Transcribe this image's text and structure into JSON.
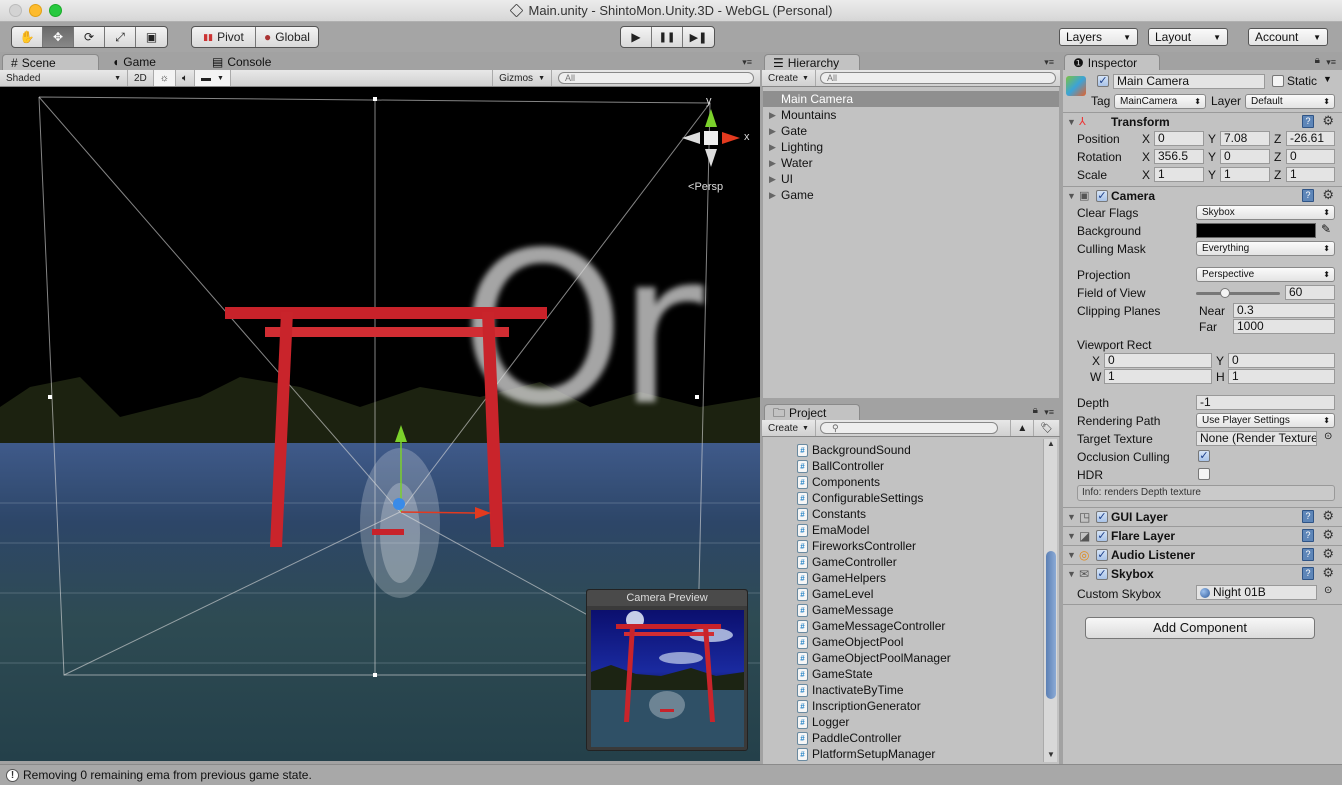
{
  "window": {
    "title": "Main.unity - ShintoMon.Unity.3D - WebGL (Personal)"
  },
  "toolbar": {
    "tools": [
      {
        "name": "hand-tool",
        "glyph": "✋"
      },
      {
        "name": "move-tool",
        "glyph": "✥"
      },
      {
        "name": "rotate-tool",
        "glyph": "⟳"
      },
      {
        "name": "scale-tool",
        "glyph": "⤢"
      },
      {
        "name": "rect-tool",
        "glyph": "▣"
      }
    ],
    "active_tool": "move-tool",
    "pivot_label": "Pivot",
    "global_label": "Global",
    "play_glyph": "▶",
    "pause_glyph": "❚❚",
    "step_glyph": "▶❚",
    "layers_label": "Layers",
    "layout_label": "Layout",
    "account_label": "Account"
  },
  "scene_panel": {
    "tabs": [
      {
        "label": "Scene",
        "icon": "#"
      },
      {
        "label": "Game",
        "icon": "◖"
      },
      {
        "label": "Console",
        "icon": "▤"
      }
    ],
    "shading_mode": "Shaded",
    "mode_2d_label": "2D",
    "gizmos_label": "Gizmos",
    "search_placeholder": "All",
    "gizmo_y": "y",
    "gizmo_x": "x",
    "projection_label": "Persp",
    "overlay_text": "Or",
    "camera_preview_title": "Camera Preview"
  },
  "hierarchy": {
    "tab_label": "Hierarchy",
    "create_label": "Create",
    "search_placeholder": "All",
    "items": [
      {
        "label": "Main Camera",
        "selected": true,
        "expandable": false
      },
      {
        "label": "Mountains",
        "selected": false,
        "expandable": true
      },
      {
        "label": "Gate",
        "selected": false,
        "expandable": true
      },
      {
        "label": "Lighting",
        "selected": false,
        "expandable": true
      },
      {
        "label": "Water",
        "selected": false,
        "expandable": true
      },
      {
        "label": "UI",
        "selected": false,
        "expandable": true
      },
      {
        "label": "Game",
        "selected": false,
        "expandable": true
      }
    ]
  },
  "project": {
    "tab_label": "Project",
    "create_label": "Create",
    "search_placeholder": "",
    "files": [
      "BackgroundSound",
      "BallController",
      "Components",
      "ConfigurableSettings",
      "Constants",
      "EmaModel",
      "FireworksController",
      "GameController",
      "GameHelpers",
      "GameLevel",
      "GameMessage",
      "GameMessageController",
      "GameObjectPool",
      "GameObjectPoolManager",
      "GameState",
      "InactivateByTime",
      "InscriptionGenerator",
      "Logger",
      "PaddleController",
      "PlatformSetupManager"
    ]
  },
  "inspector": {
    "tab_label": "Inspector",
    "object_name": "Main Camera",
    "active": true,
    "static_label": "Static",
    "static": false,
    "tag_label": "Tag",
    "tag_value": "MainCamera",
    "layer_label": "Layer",
    "layer_value": "Default",
    "transform": {
      "title": "Transform",
      "position_label": "Position",
      "rotation_label": "Rotation",
      "scale_label": "Scale",
      "position": {
        "x": "0",
        "y": "7.08",
        "z": "-26.61"
      },
      "rotation": {
        "x": "356.5",
        "y": "0",
        "z": "0"
      },
      "scale": {
        "x": "1",
        "y": "1",
        "z": "1"
      }
    },
    "camera": {
      "title": "Camera",
      "enabled": true,
      "clear_flags_label": "Clear Flags",
      "clear_flags": "Skybox",
      "background_label": "Background",
      "background_color": "#000000",
      "culling_mask_label": "Culling Mask",
      "culling_mask": "Everything",
      "projection_label": "Projection",
      "projection": "Perspective",
      "fov_label": "Field of View",
      "fov": "60",
      "fov_slider_fraction": 0.35,
      "clipping_label": "Clipping Planes",
      "near_label": "Near",
      "near": "0.3",
      "far_label": "Far",
      "far": "1000",
      "viewport_label": "Viewport Rect",
      "viewport": {
        "x": "0",
        "y": "0",
        "w": "1",
        "h": "1"
      },
      "depth_label": "Depth",
      "depth": "-1",
      "rendering_path_label": "Rendering Path",
      "rendering_path": "Use Player Settings",
      "target_texture_label": "Target Texture",
      "target_texture": "None (Render Texture)",
      "occlusion_label": "Occlusion Culling",
      "occlusion": true,
      "hdr_label": "HDR",
      "hdr": false,
      "info": "Info: renders Depth texture"
    },
    "components": [
      {
        "title": "GUI Layer",
        "enabled": true
      },
      {
        "title": "Flare Layer",
        "enabled": true
      },
      {
        "title": "Audio Listener",
        "enabled": true
      },
      {
        "title": "Skybox",
        "enabled": true
      }
    ],
    "skybox": {
      "custom_label": "Custom Skybox",
      "custom_value": "Night 01B"
    },
    "add_component_label": "Add Component"
  },
  "status": {
    "message": "Removing 0 remaining ema from previous game state."
  },
  "colors": {
    "torii_red": "#d42a2a",
    "gizmo_green": "#7bd12b",
    "gizmo_red": "#e33a1f",
    "gizmo_blue": "#3a8be8"
  }
}
